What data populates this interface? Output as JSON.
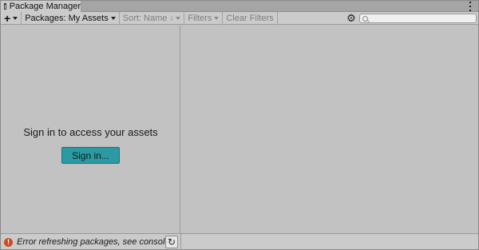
{
  "window": {
    "tab_title": "Package Manager",
    "tab_icon": "package-window-icon",
    "menu_icon": "kebab-menu-icon"
  },
  "toolbar": {
    "add_label": "+",
    "packages_label": "Packages: My Assets",
    "sort_label": "Sort: Name",
    "sort_direction_glyph": "↓",
    "filters_label": "Filters",
    "clear_filters_label": "Clear Filters",
    "settings_icon": "gear-icon",
    "search_placeholder": "",
    "search_value": ""
  },
  "left_pane": {
    "message": "Sign in to access your assets",
    "sign_in_label": "Sign in..."
  },
  "status": {
    "error_text": "Error refreshing packages, see console",
    "error_icon": "error-icon",
    "refresh_icon": "refresh-icon"
  },
  "colors": {
    "accent_button": "#2b9aa3",
    "error": "#d14a1e",
    "background": "#c2c2c2"
  }
}
